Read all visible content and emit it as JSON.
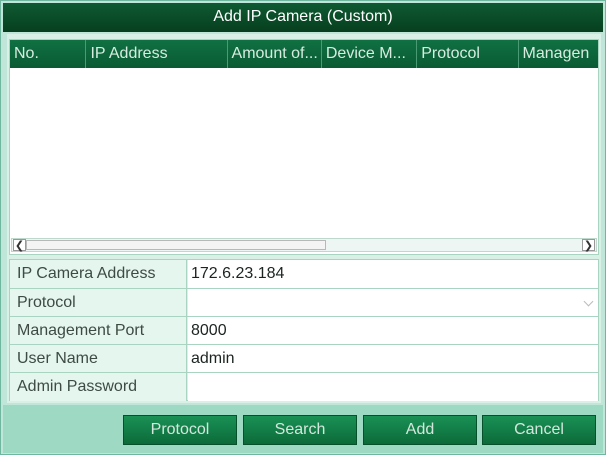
{
  "dialog": {
    "title": "Add IP Camera (Custom)"
  },
  "table": {
    "columns": [
      "No.",
      "IP Address",
      "Amount of...",
      "Device M...",
      "Protocol",
      "Managen"
    ],
    "rows": []
  },
  "form": {
    "ip_address": {
      "label": "IP Camera Address",
      "value": "172.6.23.184"
    },
    "protocol": {
      "label": "Protocol",
      "value": ""
    },
    "management_port": {
      "label": "Management Port",
      "value": "8000"
    },
    "user_name": {
      "label": "User Name",
      "value": "admin"
    },
    "admin_password": {
      "label": "Admin Password",
      "value": ""
    }
  },
  "buttons": {
    "protocol": "Protocol",
    "search": "Search",
    "add": "Add",
    "cancel": "Cancel"
  },
  "scrollbar": {
    "left_arrow": "❮",
    "right_arrow": "❯"
  }
}
